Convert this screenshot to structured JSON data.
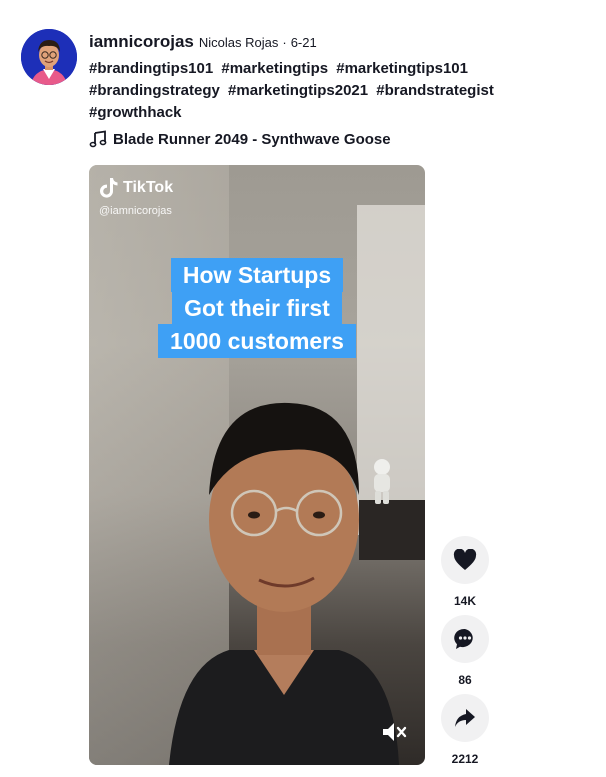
{
  "post": {
    "username": "iamnicorojas",
    "nickname": "Nicolas Rojas",
    "separator": "·",
    "date": "6-21",
    "hashtags": [
      "#brandingtips101",
      "#marketingtips",
      "#marketingtips101",
      "#brandingstrategy",
      "#marketingtips2021",
      "#brandstrategist",
      "#growthhack"
    ],
    "music": "Blade Runner 2049 - Synthwave Goose"
  },
  "video": {
    "watermark_brand": "TikTok",
    "watermark_user": "@iamnicorojas",
    "caption_lines": [
      "How Startups",
      "Got their first",
      "1000 customers"
    ],
    "muted": true
  },
  "actions": {
    "likes": "14K",
    "comments": "86",
    "shares": "2212"
  },
  "colors": {
    "caption_bg": "#3ea0f5",
    "action_bg": "#f1f1f2",
    "text": "#161823"
  }
}
